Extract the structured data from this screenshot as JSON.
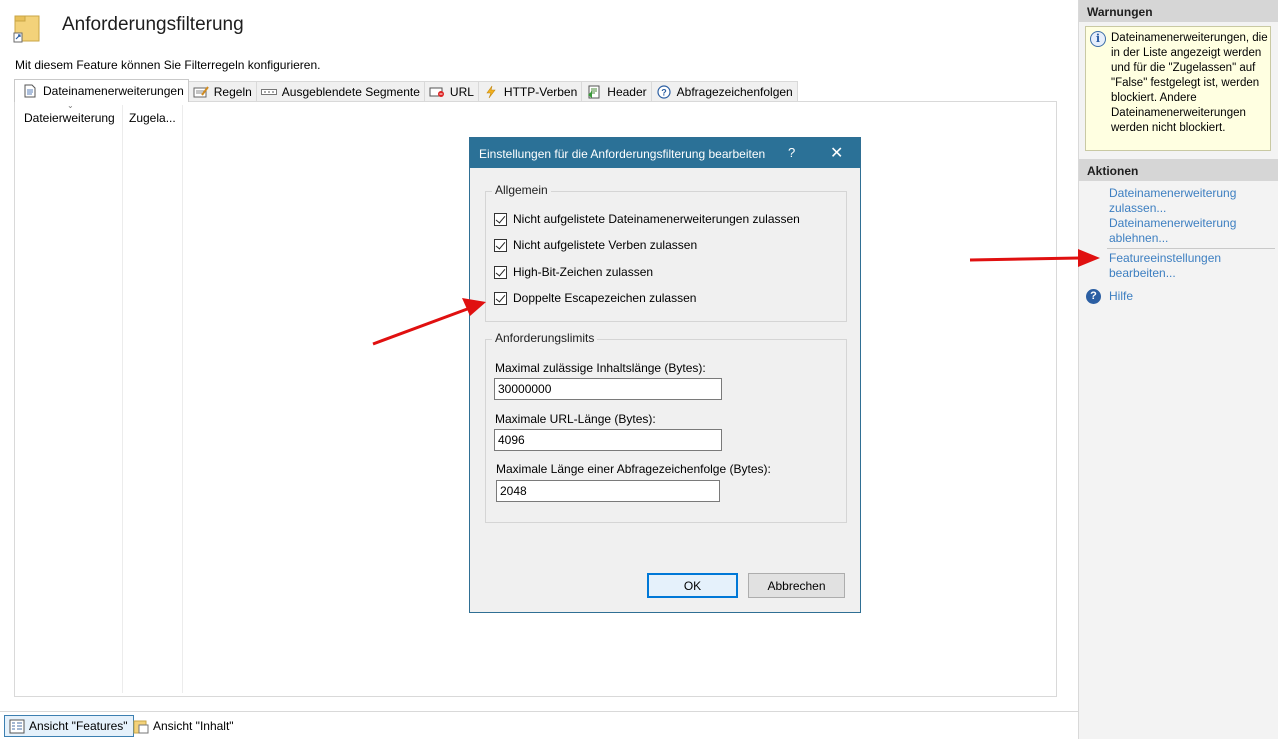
{
  "header": {
    "title": "Anforderungsfilterung",
    "description": "Mit diesem Feature können Sie Filterregeln konfigurieren."
  },
  "tabs": [
    {
      "label": "Dateinamenerweiterungen",
      "icon": "file-icon",
      "active": true
    },
    {
      "label": "Regeln",
      "icon": "rules-icon"
    },
    {
      "label": "Ausgeblendete Segmente",
      "icon": "segments-icon"
    },
    {
      "label": "URL",
      "icon": "url-icon"
    },
    {
      "label": "HTTP-Verben",
      "icon": "lightning-icon"
    },
    {
      "label": "Header",
      "icon": "header-icon"
    },
    {
      "label": "Abfragezeichenfolgen",
      "icon": "question-icon"
    }
  ],
  "list": {
    "columns": [
      "Dateierweiterung",
      "Zugela..."
    ]
  },
  "views": {
    "features": "Ansicht \"Features\"",
    "content": "Ansicht \"Inhalt\""
  },
  "right_pane": {
    "warnings_header": "Warnungen",
    "warning_text": "Dateinamenerweiterungen, die in der Liste angezeigt werden und für die \"Zugelassen\" auf \"False\" festgelegt ist, werden blockiert. Andere Dateinamenerweiterungen werden nicht blockiert.",
    "actions_header": "Aktionen",
    "actions": [
      "Dateinamenerweiterung zulassen...",
      "Dateinamenerweiterung ablehnen...",
      "Featureeinstellungen bearbeiten...",
      "Hilfe"
    ]
  },
  "dialog": {
    "title": "Einstellungen für die Anforderungsfilterung bearbeiten",
    "help_glyph": "?",
    "close_glyph": "✕",
    "general_group": "Allgemein",
    "checkboxes": [
      {
        "label": "Nicht aufgelistete Dateinamenerweiterungen zulassen",
        "checked": true
      },
      {
        "label": "Nicht aufgelistete Verben zulassen",
        "checked": true
      },
      {
        "label": "High-Bit-Zeichen zulassen",
        "checked": true
      },
      {
        "label": "Doppelte Escapezeichen zulassen",
        "checked": true
      }
    ],
    "limits_group": "Anforderungslimits",
    "fields": [
      {
        "label": "Maximal zulässige Inhaltslänge (Bytes):",
        "value": "30000000"
      },
      {
        "label": "Maximale URL-Länge (Bytes):",
        "value": "4096"
      },
      {
        "label": "Maximale Länge einer Abfragezeichenfolge (Bytes):",
        "value": "2048"
      }
    ],
    "ok_label": "OK",
    "cancel_label": "Abbrechen"
  },
  "colors": {
    "dialog_titlebar": "#2b7197",
    "link": "#3d7fc1",
    "warning_bg": "#ffffe1",
    "arrow": "#e01010"
  }
}
